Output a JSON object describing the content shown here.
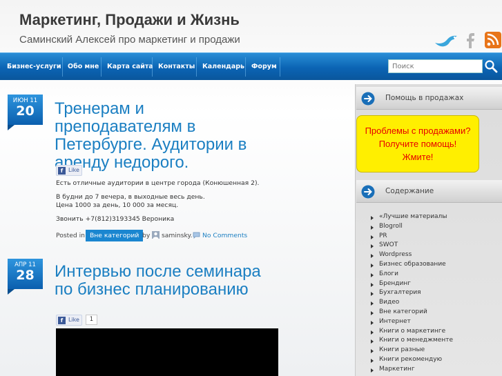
{
  "header": {
    "title": "Маркетинг, Продажи и Жизнь",
    "description": "Саминский Алексей про маркетинг и продажи",
    "social": [
      "twitter-icon",
      "facebook-icon",
      "rss-icon"
    ]
  },
  "nav": {
    "items": [
      "Бизнес-услуги",
      "Обо мне",
      "Карта сайта",
      "Контакты",
      "Календарь",
      "Форум"
    ]
  },
  "search": {
    "placeholder": "Поиск"
  },
  "posts": [
    {
      "date_month": "ИЮН 11",
      "date_day": "20",
      "title": "Тренерам и преподавателям в Петербурге. Аудитории в аренду недорого.",
      "like_label": "Like",
      "lines": [
        "Есть отличные аудитории в центре города (Конюшенная 2).",
        "В будни до 7 вечера, в выходные весь день.",
        "Цена 1000 за день, 10 000 за месяц.",
        "Звонить +7(812)3193345 Вероника"
      ],
      "meta": {
        "posted_in": "Posted in",
        "category": "Вне категорий",
        "by": "by",
        "author": "saminsky.",
        "comments": "No Comments"
      }
    },
    {
      "date_month": "АПР 11",
      "date_day": "28",
      "title": "Интервью после семинара по бизнес планированию",
      "like_label": "Like",
      "like_count": "1"
    }
  ],
  "sidebar": {
    "help_title": "Помощь в продажах",
    "promo_lines": [
      "Проблемы с продажами?",
      "Получите помощь!",
      "Жмите!"
    ],
    "contents_title": "Содержание",
    "categories": [
      "«Лучшие материалы",
      "Blogroll",
      "PR",
      "SWOT",
      "Wordpress",
      "Бизнес образование",
      "Блоги",
      "Брендинг",
      "Бухгалтерия",
      "Видео",
      "Вне категорий",
      "Интернет",
      "Книги о маркетинге",
      "Книги о менеджменте",
      "Книги разные",
      "Книги рекомендую",
      "Маркетинг"
    ]
  },
  "colors": {
    "accent": "#1b7fc2",
    "nav": "#0b64b4",
    "promo_bg": "#ffef00",
    "promo_text": "#e60000"
  }
}
